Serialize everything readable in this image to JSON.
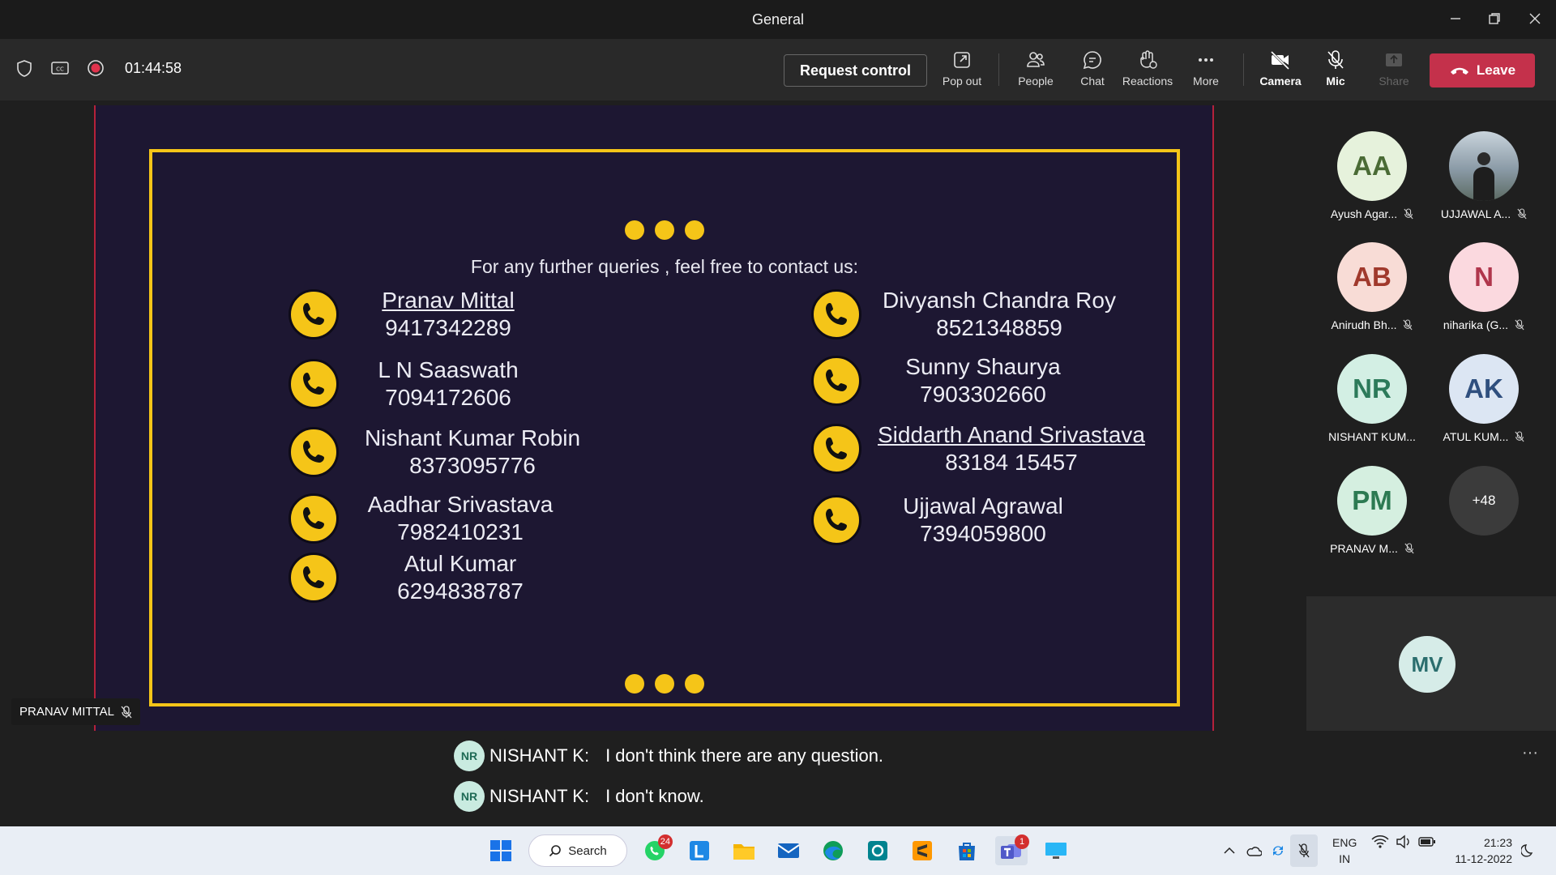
{
  "window": {
    "title": "General"
  },
  "toolbar": {
    "timer": "01:44:58",
    "request_control": "Request control",
    "pop_out": "Pop out",
    "people": "People",
    "chat": "Chat",
    "reactions": "Reactions",
    "more": "More",
    "camera": "Camera",
    "mic": "Mic",
    "share": "Share",
    "leave": "Leave"
  },
  "slide": {
    "intro": "For any further queries , feel free to contact us:",
    "left_contacts": [
      {
        "name": "Pranav Mittal",
        "phone": "9417342289"
      },
      {
        "name": "L N Saaswath",
        "phone": "7094172606"
      },
      {
        "name": "Nishant Kumar Robin",
        "phone": "8373095776"
      },
      {
        "name": "Aadhar Srivastava",
        "phone": "7982410231"
      },
      {
        "name": "Atul Kumar",
        "phone": "6294838787"
      }
    ],
    "right_contacts": [
      {
        "name": "Divyansh Chandra Roy",
        "phone": "8521348859"
      },
      {
        "name": "Sunny Shaurya",
        "phone": "7903302660"
      },
      {
        "name": "Siddarth Anand Srivastava",
        "phone": "83184 15457"
      },
      {
        "name": "Ujjawal Agrawal",
        "phone": "7394059800"
      }
    ]
  },
  "presenter": {
    "name": "PRANAV MITTAL"
  },
  "participants": [
    {
      "initials": "AA",
      "name": "Ayush Agar...",
      "bg": "#e6f2dc",
      "fg": "#4a6b35"
    },
    {
      "initials": "",
      "name": "UJJAWAL A...",
      "bg": "#8a9aa6",
      "fg": "#ffffff"
    },
    {
      "initials": "AB",
      "name": "Anirudh Bh...",
      "bg": "#f8dcd6",
      "fg": "#a0392c"
    },
    {
      "initials": "N",
      "name": "niharika (G...",
      "bg": "#fbd9df",
      "fg": "#b0364c"
    },
    {
      "initials": "NR",
      "name": "NISHANT KUM...",
      "bg": "#d3efe4",
      "fg": "#2c7a5a"
    },
    {
      "initials": "AK",
      "name": "ATUL KUM...",
      "bg": "#dce6f3",
      "fg": "#2f4f7e"
    },
    {
      "initials": "PM",
      "name": "PRANAV M...",
      "bg": "#d5efe0",
      "fg": "#2c7a52"
    }
  ],
  "more_participants": "+48",
  "self_view": {
    "initials": "MV"
  },
  "captions": [
    {
      "initials": "NR",
      "speaker": "NISHANT K:",
      "text": "I don't think there are any question."
    },
    {
      "initials": "NR",
      "speaker": "NISHANT K:",
      "text": "I don't know."
    }
  ],
  "taskbar": {
    "search": "Search",
    "whatsapp_badge": "24",
    "teams_badge": "1",
    "lang_top": "ENG",
    "lang_bottom": "IN",
    "time": "21:23",
    "date": "11-12-2022"
  }
}
